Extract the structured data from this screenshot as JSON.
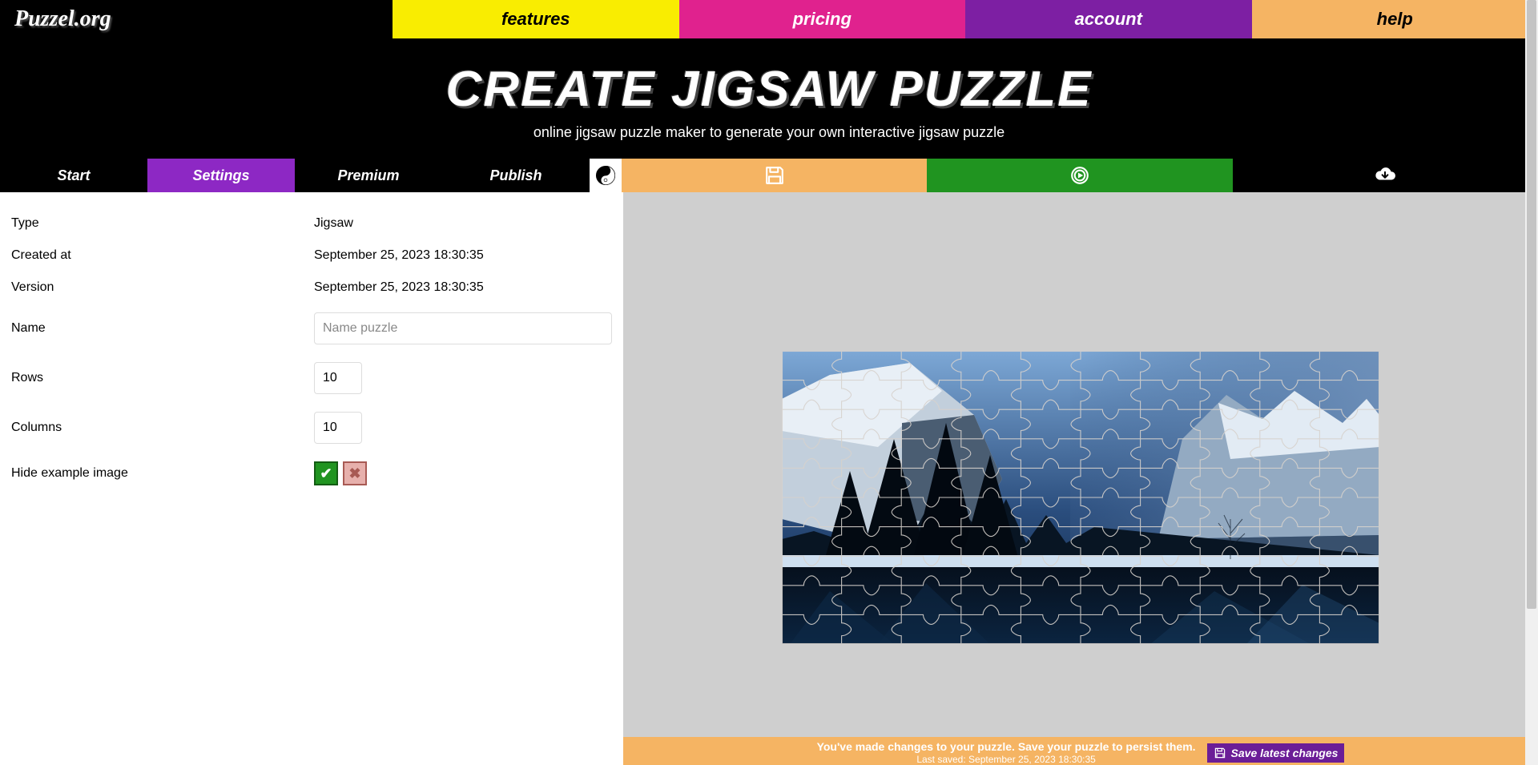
{
  "brand": "Puzzel.org",
  "nav": {
    "features": "features",
    "pricing": "pricing",
    "account": "account",
    "help": "help"
  },
  "hero": {
    "title": "CREATE JIGSAW PUZZLE",
    "subtitle": "online jigsaw puzzle maker to generate your own interactive jigsaw puzzle"
  },
  "subtabs": {
    "start": "Start",
    "settings": "Settings",
    "premium": "Premium",
    "publish": "Publish"
  },
  "settings": {
    "labels": {
      "type": "Type",
      "created_at": "Created at",
      "version": "Version",
      "name": "Name",
      "rows": "Rows",
      "columns": "Columns",
      "hide_example": "Hide example image"
    },
    "values": {
      "type": "Jigsaw",
      "created_at": "September 25, 2023 18:30:35",
      "version": "September 25, 2023 18:30:35",
      "name_placeholder": "Name puzzle",
      "rows": "10",
      "columns": "10"
    }
  },
  "savebar": {
    "msg": "You've made changes to your puzzle. Save your puzzle to persist them.",
    "last_saved": "Last saved: September 25, 2023 18:30:35",
    "button": "Save latest changes"
  }
}
